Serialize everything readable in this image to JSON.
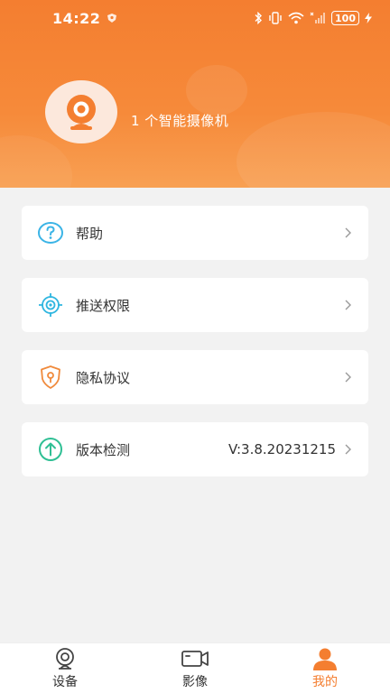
{
  "status_bar": {
    "time": "14:22",
    "battery": "100"
  },
  "profile": {
    "camera_count_text": "1 个智能摄像机"
  },
  "menu": {
    "items": [
      {
        "label": "帮助",
        "icon": "help-circle-icon",
        "value": ""
      },
      {
        "label": "推送权限",
        "icon": "target-icon",
        "value": ""
      },
      {
        "label": "隐私协议",
        "icon": "shield-icon",
        "value": ""
      },
      {
        "label": "版本检测",
        "icon": "upload-arrow-icon",
        "value": "V:3.8.20231215"
      }
    ]
  },
  "tabbar": {
    "tabs": [
      {
        "label": "设备",
        "icon": "webcam-icon",
        "active": false
      },
      {
        "label": "影像",
        "icon": "video-camera-icon",
        "active": false
      },
      {
        "label": "我的",
        "icon": "person-icon",
        "active": true
      }
    ]
  },
  "colors": {
    "accent": "#f47e30",
    "help_icon": "#3bb4e6",
    "target_icon": "#2fb6e0",
    "shield_icon": "#f08a3c",
    "upload_icon": "#2fbf94"
  }
}
